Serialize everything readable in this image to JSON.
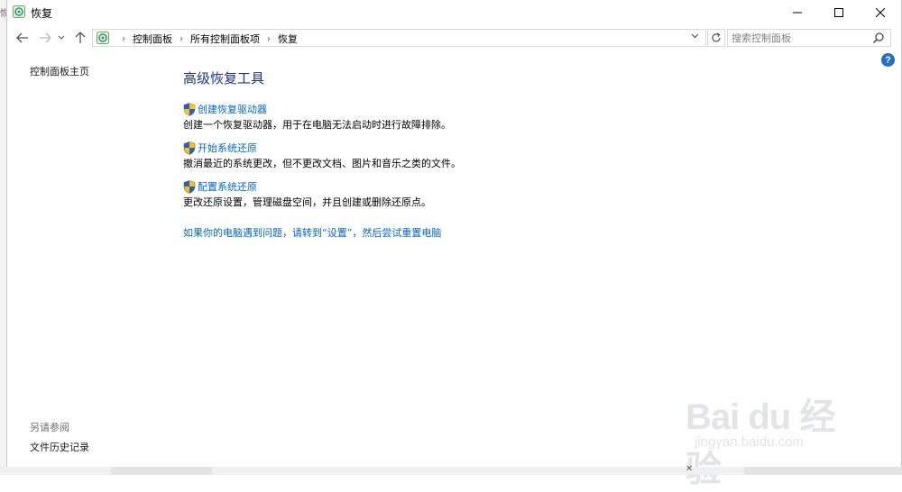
{
  "window": {
    "title": "恢复",
    "left_edge_text": "恢"
  },
  "nav": {
    "breadcrumb": [
      "控制面板",
      "所有控制面板项",
      "恢复"
    ]
  },
  "search": {
    "placeholder": "搜索控制面板"
  },
  "left_pane": {
    "home_link": "控制面板主页",
    "see_also_heading": "另请参阅",
    "file_history_link": "文件历史记录"
  },
  "main": {
    "title": "高级恢复工具",
    "items": [
      {
        "link": "创建恢复驱动器",
        "description": "创建一个恢复驱动器，用于在电脑无法启动时进行故障排除。"
      },
      {
        "link": "开始系统还原",
        "description": "撤消最近的系统更改，但不更改文档、图片和音乐之类的文件。"
      },
      {
        "link": "配置系统还原",
        "description": "更改还原设置，管理磁盘空间，并且创建或删除还原点。"
      }
    ],
    "reset_link": "如果你的电脑遇到问题，请转到“设置”，然后尝试重置电脑"
  },
  "watermark": {
    "logo": "Bai du 经验",
    "url": "jingyan.baidu.com"
  },
  "colors": {
    "link": "#0066cc",
    "title": "#1e3287",
    "help": "#1f6fc8"
  }
}
